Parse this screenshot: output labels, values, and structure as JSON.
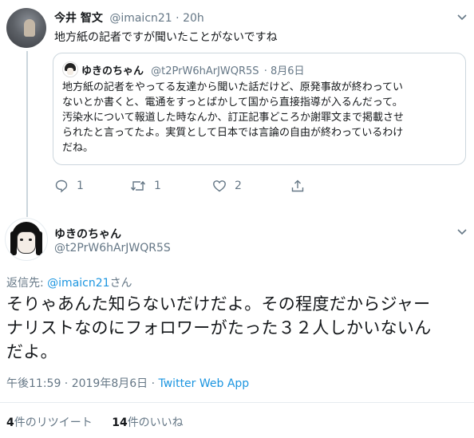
{
  "reply_tweet": {
    "author_name": "今井 智文",
    "handle": "@imaicn21",
    "time": "20h",
    "text": "地方紙の記者ですが聞いたことがないですね",
    "actions": {
      "replies": "1",
      "retweets": "1",
      "likes": "2"
    }
  },
  "quoted_tweet": {
    "author_name": "ゆきのちゃん",
    "handle": "@t2PrW6hArJWQR5S",
    "date": "· 8月6日",
    "lines": [
      "地方紙の記者をやってる友達から聞いた話だけど、原発事故が終わってい",
      "ないとか書くと、電通をすっとばかして国から直接指導が入るんだって。",
      "汚染水について報道した時なんか、訂正記事どころか謝罪文まで掲載させ",
      "られたと言ってたよ。実質として日本では言論の自由が終わっているわけ",
      "だね。"
    ]
  },
  "main_tweet": {
    "author_name": "ゆきのちゃん",
    "handle": "@t2PrW6hArJWQR5S",
    "reply_to_prefix": "返信先: ",
    "reply_to_handle": "@imaicn21",
    "reply_to_suffix": "さん",
    "lines": [
      "そりゃあんた知らないだけだよ。その程度だからジャー",
      "ナリストなのにフォロワーがたった３２人しかいないん",
      "だよ。"
    ],
    "timestamp": "午後11:59 · 2019年8月6日 · ",
    "source": "Twitter Web App",
    "retweet_count": "4",
    "retweet_label": "件のリツイート",
    "like_count": "14",
    "like_label": "件のいいね"
  },
  "colors": {
    "accent": "#1b95e0",
    "muted": "#657786",
    "border": "#ccd6dd"
  },
  "icons": [
    "reply-icon",
    "retweet-icon",
    "like-icon",
    "share-icon",
    "chevron-down-icon"
  ]
}
